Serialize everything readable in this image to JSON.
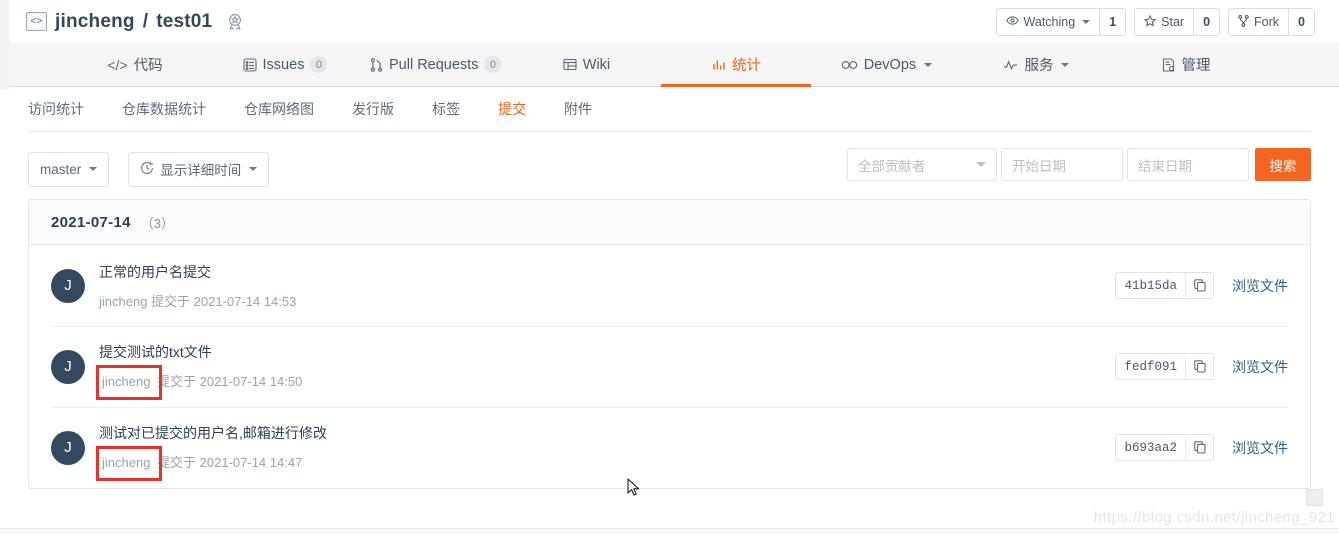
{
  "repo": {
    "code_icon": "code-icon",
    "owner": "jincheng",
    "separator": "/",
    "name": "test01",
    "badge_icon": "award-icon"
  },
  "header_actions": {
    "watching": {
      "icon": "eye-icon",
      "label": "Watching",
      "count": "1"
    },
    "star": {
      "icon": "star-icon",
      "label": "Star",
      "count": "0"
    },
    "fork": {
      "icon": "fork-icon",
      "label": "Fork",
      "count": "0"
    }
  },
  "main_nav": [
    {
      "icon": "code-brackets-icon",
      "label": "代码",
      "badge": null,
      "active": false,
      "caret": false
    },
    {
      "icon": "issues-icon",
      "label": "Issues",
      "badge": "0",
      "active": false,
      "caret": false
    },
    {
      "icon": "pull-request-icon",
      "label": "Pull Requests",
      "badge": "0",
      "active": false,
      "caret": false
    },
    {
      "icon": "wiki-icon",
      "label": "Wiki",
      "badge": null,
      "active": false,
      "caret": false
    },
    {
      "icon": "chart-bar-icon",
      "label": "统计",
      "badge": null,
      "active": true,
      "caret": false
    },
    {
      "icon": "infinity-icon",
      "label": "DevOps",
      "badge": null,
      "active": false,
      "caret": true
    },
    {
      "icon": "pulse-icon",
      "label": "服务",
      "badge": null,
      "active": false,
      "caret": true
    },
    {
      "icon": "settings-doc-icon",
      "label": "管理",
      "badge": null,
      "active": false,
      "caret": false
    }
  ],
  "sub_nav": [
    {
      "label": "访问统计",
      "active": false
    },
    {
      "label": "仓库数据统计",
      "active": false
    },
    {
      "label": "仓库网络图",
      "active": false
    },
    {
      "label": "发行版",
      "active": false
    },
    {
      "label": "标签",
      "active": false
    },
    {
      "label": "提交",
      "active": true
    },
    {
      "label": "附件",
      "active": false
    }
  ],
  "toolbar": {
    "branch_label": "master",
    "time_toggle_label": "显示详细时间",
    "time_toggle_icon": "clock-icon",
    "contributor_placeholder": "全部贡献者",
    "start_date_placeholder": "开始日期",
    "end_date_placeholder": "结束日期",
    "search_label": "搜索"
  },
  "commit_group": {
    "date": "2021-07-14",
    "count": "（3）",
    "commits": [
      {
        "avatar_initial": "J",
        "message": "正常的用户名提交",
        "author": "jincheng",
        "meta_suffix": " 提交于 2021-07-14 14:53",
        "hash": "41b15da",
        "copy_icon": "copy-icon",
        "browse_label": "浏览文件",
        "highlighted": false
      },
      {
        "avatar_initial": "J",
        "message": "提交测试的txt文件",
        "author": "jincheng",
        "meta_suffix": " 提交于 2021-07-14 14:50",
        "hash": "fedf091",
        "copy_icon": "copy-icon",
        "browse_label": "浏览文件",
        "highlighted": true
      },
      {
        "avatar_initial": "J",
        "message": "测试对已提交的用户名,邮箱进行修改",
        "author": "jincheng",
        "meta_suffix": " 提交于 2021-07-14 14:47",
        "hash": "b693aa2",
        "copy_icon": "copy-icon",
        "browse_label": "浏览文件",
        "highlighted": true
      }
    ]
  },
  "watermark": "https://blog.csdn.net/jincheng_921",
  "colors": {
    "accent": "#f26522",
    "annotation": "#e8322b",
    "avatar": "#35495e",
    "link": "#2f5d8c"
  }
}
